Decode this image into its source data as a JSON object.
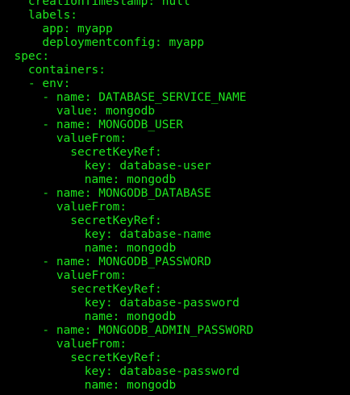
{
  "colors": {
    "background": "#000000",
    "text": "#1ee51e"
  },
  "lines": [
    "    creationTimestamp: null",
    "    labels:",
    "      app: myapp",
    "      deploymentconfig: myapp",
    "  spec:",
    "    containers:",
    "    - env:",
    "      - name: DATABASE_SERVICE_NAME",
    "        value: mongodb",
    "      - name: MONGODB_USER",
    "        valueFrom:",
    "          secretKeyRef:",
    "            key: database-user",
    "            name: mongodb",
    "      - name: MONGODB_DATABASE",
    "        valueFrom:",
    "          secretKeyRef:",
    "            key: database-name",
    "            name: mongodb",
    "      - name: MONGODB_PASSWORD",
    "        valueFrom:",
    "          secretKeyRef:",
    "            key: database-password",
    "            name: mongodb",
    "      - name: MONGODB_ADMIN_PASSWORD",
    "        valueFrom:",
    "          secretKeyRef:",
    "            key: database-password",
    "            name: mongodb"
  ]
}
